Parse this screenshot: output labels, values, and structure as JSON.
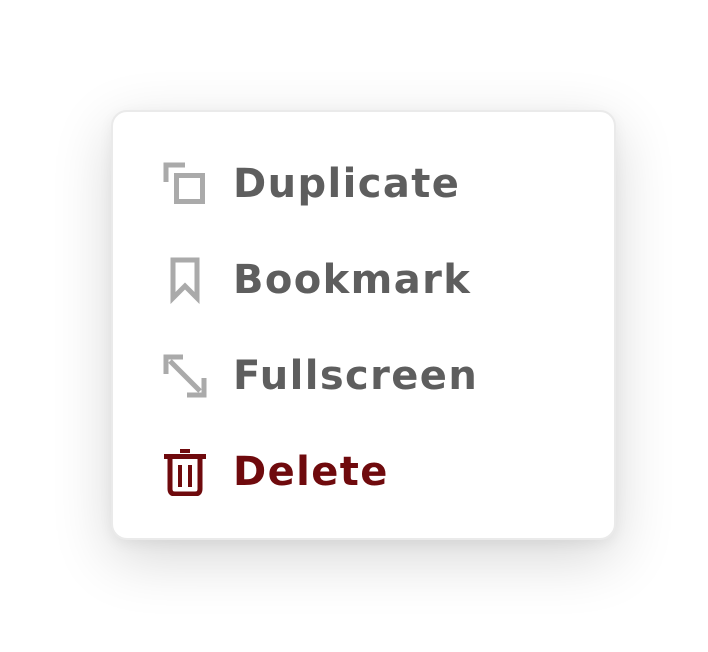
{
  "menu": {
    "items": [
      {
        "label": "Duplicate",
        "icon": "duplicate-icon",
        "color": "#5e5e5e"
      },
      {
        "label": "Bookmark",
        "icon": "bookmark-icon",
        "color": "#5e5e5e"
      },
      {
        "label": "Fullscreen",
        "icon": "fullscreen-icon",
        "color": "#5e5e5e"
      },
      {
        "label": "Delete",
        "icon": "trash-icon",
        "color": "#6f0a0d"
      }
    ]
  },
  "colors": {
    "text": "#5e5e5e",
    "icon": "#aaaaaa",
    "danger": "#6f0a0d",
    "background": "#ffffff"
  }
}
